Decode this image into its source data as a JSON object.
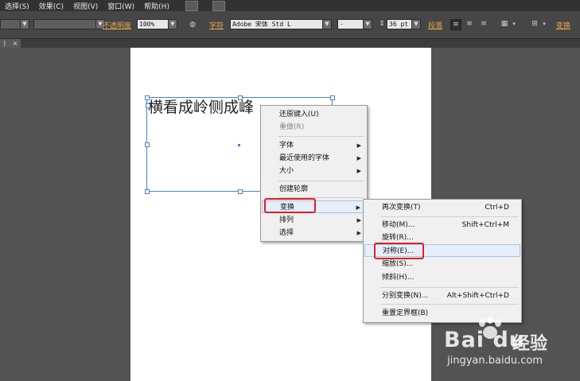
{
  "menubar": {
    "items": [
      "选择(S)",
      "效果(C)",
      "视图(V)",
      "窗口(W)",
      "帮助(H)"
    ]
  },
  "control_bar": {
    "opacity_label": "不透明度",
    "opacity_value": "100%",
    "char_label": "字符",
    "font_family": "Adobe 宋体 Std L",
    "font_style": "-",
    "font_size": "36 pt",
    "paragraph_label": "段落",
    "transform_label": "变换"
  },
  "document": {
    "tab_close": "×",
    "tab_left": ")",
    "text_content": "横看成岭侧成峰"
  },
  "context_menu": {
    "items": [
      {
        "label": "还原键入(U)",
        "enabled": true
      },
      {
        "label": "重做(R)",
        "enabled": false
      },
      {
        "label": "字体",
        "submenu": true
      },
      {
        "label": "最近使用的字体",
        "submenu": true
      },
      {
        "label": "大小",
        "submenu": true
      },
      {
        "label": "创建轮廓"
      },
      {
        "label": "变换",
        "submenu": true,
        "highlighted": true
      },
      {
        "label": "排列",
        "submenu": true
      },
      {
        "label": "选择",
        "submenu": true
      }
    ]
  },
  "transform_submenu": {
    "items": [
      {
        "label": "再次变换(T)",
        "shortcut": "Ctrl+D"
      },
      {
        "label": "移动(M)...",
        "shortcut": "Shift+Ctrl+M"
      },
      {
        "label": "旋转(R)...",
        "shortcut": ""
      },
      {
        "label": "对称(E)...",
        "shortcut": "",
        "highlighted": true
      },
      {
        "label": "缩放(S)...",
        "shortcut": ""
      },
      {
        "label": "倾斜(H)...",
        "shortcut": ""
      },
      {
        "label": "分别变换(N)...",
        "shortcut": "Alt+Shift+Ctrl+D"
      },
      {
        "label": "重置定界框(B)",
        "shortcut": ""
      }
    ]
  },
  "watermark": {
    "logo": "Bai du",
    "logo_cn": "经验",
    "url": "jingyan.baidu.com"
  },
  "colors": {
    "selection": "#4a7fd4",
    "highlight_box": "#e02020",
    "label_orange": "#e9a64a"
  }
}
